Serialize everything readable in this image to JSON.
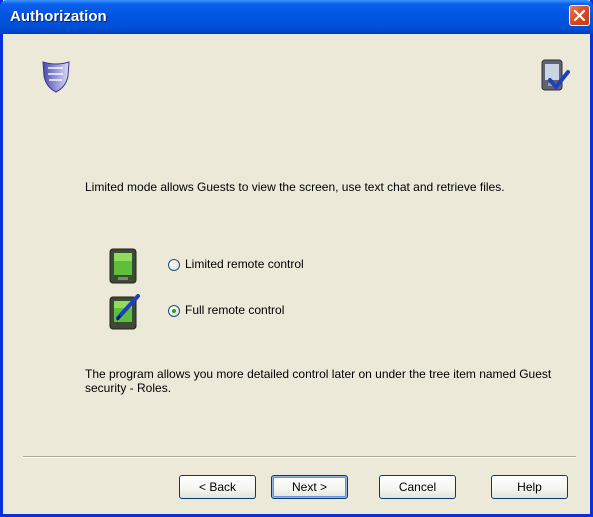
{
  "window": {
    "title": "Authorization"
  },
  "description": "Limited mode allows Guests to view the screen, use text chat and retrieve files.",
  "options": [
    {
      "label": "Limited remote control",
      "selected": false,
      "icon": "pda-icon"
    },
    {
      "label": "Full remote control",
      "selected": true,
      "icon": "pda-pen-icon"
    }
  ],
  "note": "The program allows you more detailed control later on under the tree item named Guest security - Roles.",
  "buttons": {
    "back": "< Back",
    "next": "Next >",
    "cancel": "Cancel",
    "help": "Help"
  },
  "colors": {
    "titlebar": "#0054e3",
    "dialog_bg": "#ece9d8",
    "close_button": "#d5471f",
    "radio_dot": "#21a121"
  }
}
